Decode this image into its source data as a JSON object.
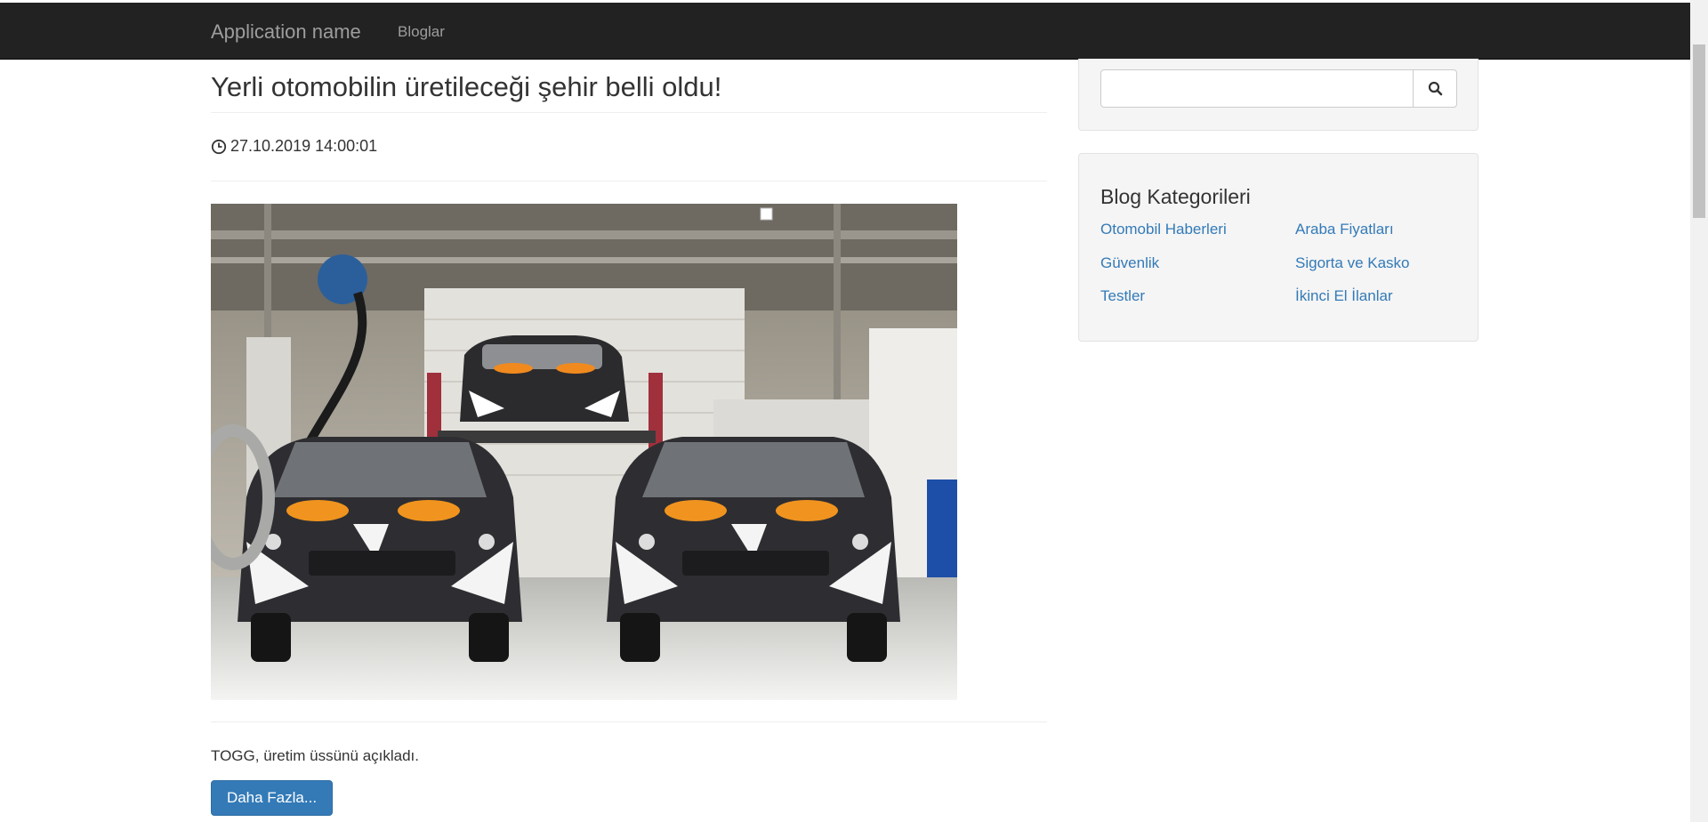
{
  "nav": {
    "brand": "Application name",
    "links": [
      "Bloglar"
    ]
  },
  "post": {
    "title": "Yerli otomobilin üretileceği şehir belli oldu!",
    "timestamp": "27.10.2019 14:00:01",
    "excerpt": "TOGG, üretim üssünü açıkladı.",
    "more_label": "Daha Fazla..."
  },
  "search": {
    "value": "",
    "placeholder": ""
  },
  "sidebar": {
    "categories_title": "Blog Kategorileri",
    "categories": [
      "Otomobil Haberleri",
      "Araba Fiyatları",
      "Güvenlik",
      "Sigorta ve Kasko",
      "Testler",
      "İkinci El İlanlar"
    ]
  },
  "icons": {
    "time": "clock-icon",
    "search": "search-icon"
  }
}
